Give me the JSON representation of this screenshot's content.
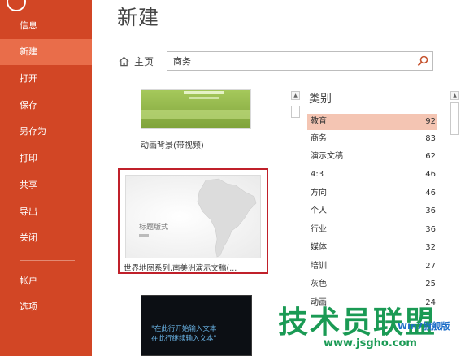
{
  "sidebar": {
    "items": [
      {
        "label": "信息"
      },
      {
        "label": "新建",
        "active": true
      },
      {
        "label": "打开"
      },
      {
        "label": "保存"
      },
      {
        "label": "另存为"
      },
      {
        "label": "打印"
      },
      {
        "label": "共享"
      },
      {
        "label": "导出"
      },
      {
        "label": "关闭"
      },
      {
        "label": "帐户"
      },
      {
        "label": "选项"
      }
    ]
  },
  "main": {
    "title": "新建",
    "home_label": "主页",
    "search": {
      "value": "商务"
    }
  },
  "templates": [
    {
      "caption": "动画背景(带视频)",
      "thumb_text": []
    },
    {
      "caption": "世界地图系列,南美洲演示文稿(...",
      "thumb_title": "标题版式",
      "selected": true
    },
    {
      "caption": "",
      "thumb_lines": [
        "\"在此行开始输入文本",
        "在此行继续输入文本\""
      ]
    }
  ],
  "categories": {
    "title": "类别",
    "items": [
      {
        "name": "教育",
        "count": "92",
        "selected": true
      },
      {
        "name": "商务",
        "count": "83"
      },
      {
        "name": "演示文稿",
        "count": "62"
      },
      {
        "name": "4:3",
        "count": "46"
      },
      {
        "name": "方向",
        "count": "46"
      },
      {
        "name": "个人",
        "count": "36"
      },
      {
        "name": "行业",
        "count": "36"
      },
      {
        "name": "媒体",
        "count": "32"
      },
      {
        "name": "培训",
        "count": "27"
      },
      {
        "name": "灰色",
        "count": "25"
      },
      {
        "name": "动画",
        "count": "24"
      }
    ]
  },
  "watermark": {
    "main": "技术员联盟",
    "url": "www.jsgho.com",
    "brand": "Win7旗舰版"
  },
  "colors": {
    "sidebar": "#d24625",
    "sidebar_active": "#e96d4a",
    "category_selected": "#f4c5b3",
    "template_selected_border": "#c0202a",
    "watermark": "#1a9a54"
  },
  "icons": {
    "home": "home-icon",
    "search": "search-icon",
    "back": "back-arrow-icon"
  }
}
